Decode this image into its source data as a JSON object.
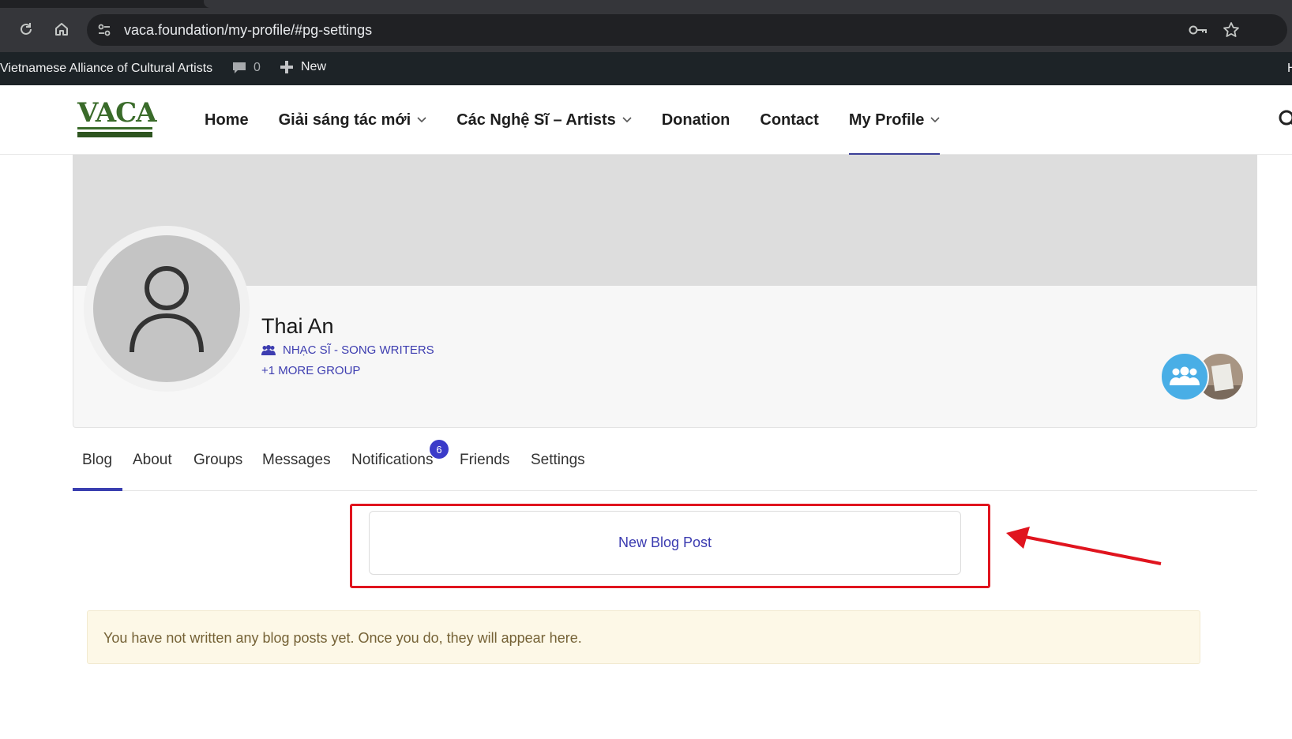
{
  "browser": {
    "url": "vaca.foundation/my-profile/#pg-settings"
  },
  "adminbar": {
    "site_name": "Vietnamese Alliance of Cultural Artists",
    "comments_count": "0",
    "new_label": "New",
    "edge_letter": "H"
  },
  "logo": {
    "text": "VACA"
  },
  "nav": {
    "items": [
      {
        "label": "Home"
      },
      {
        "label": "Giải sáng tác mới"
      },
      {
        "label": "Các Nghệ Sĩ – Artists"
      },
      {
        "label": "Donation"
      },
      {
        "label": "Contact"
      },
      {
        "label": "My Profile"
      }
    ]
  },
  "profile": {
    "name": "Thai An",
    "group": "NHẠC SĨ - SONG WRITERS",
    "more_group": "+1 MORE GROUP"
  },
  "tabs": [
    {
      "label": "Blog"
    },
    {
      "label": "About"
    },
    {
      "label": "Groups"
    },
    {
      "label": "Messages"
    },
    {
      "label": "Notifications"
    },
    {
      "label": "Friends"
    },
    {
      "label": "Settings"
    }
  ],
  "notifications_badge": "6",
  "blog": {
    "new_post_label": "New Blog Post",
    "empty_notice": "You have not written any blog posts yet. Once you do, they will appear here."
  },
  "colors": {
    "accent": "#3a3fb0",
    "highlight": "#e0141e",
    "group_avatar": "#49aee6"
  }
}
